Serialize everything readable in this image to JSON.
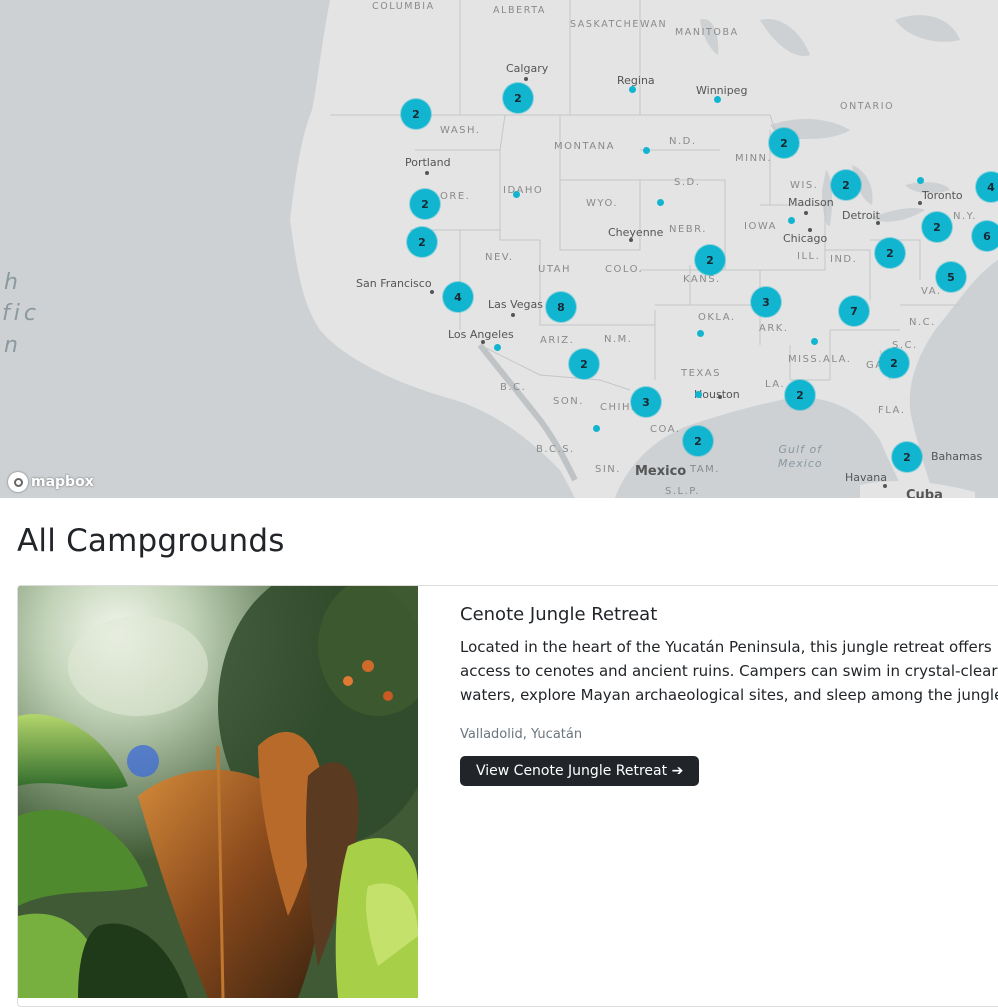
{
  "map": {
    "attribution": "mapbox",
    "pin_color": "#11b5d0",
    "clusters": [
      "2",
      "2",
      "2",
      "2",
      "2",
      "2",
      "4",
      "8",
      "2",
      "3",
      "2",
      "2",
      "3",
      "7",
      "2",
      "2",
      "2",
      "2",
      "5",
      "2",
      "4",
      "6"
    ],
    "labels": {
      "columbia": "COLUMBIA",
      "alberta": "ALBERTA",
      "saskatchewan": "SASKATCHEWAN",
      "manitoba": "MANITOBA",
      "ontario": "ONTARIO",
      "calgary": "Calgary",
      "regina": "Regina",
      "winnipeg": "Winnipeg",
      "wash": "WASH.",
      "montana": "MONTANA",
      "nd": "N.D.",
      "minn": "MINN.",
      "portland": "Portland",
      "ore": "ORE.",
      "idaho": "IDAHO",
      "wyo": "WYO.",
      "sd": "S.D.",
      "wis": "WIS.",
      "madison": "Madison",
      "toronto": "Toronto",
      "detroit": "Detroit",
      "ny": "N.Y.",
      "cheyenne": "Cheyenne",
      "nebr": "NEBR.",
      "iowa": "IOWA",
      "chicago": "Chicago",
      "nev": "NEV.",
      "utah": "UTAH",
      "colo": "COLO.",
      "ill": "ILL.",
      "ind": "IND.",
      "kans": "KANS.",
      "va": "VA.",
      "sanfrancisco": "San Francisco",
      "lasvegas": "Las Vegas",
      "okla": "OKLA.",
      "ark": "ARK.",
      "nc": "N.C.",
      "losangeles": "Los Angeles",
      "ariz": "ARIZ.",
      "nm": "N.M.",
      "sc": "S.C.",
      "miss": "MISS.",
      "ala": "ALA.",
      "ga": "GA.",
      "texas": "TEXAS",
      "bc": "B.C.",
      "la": "LA.",
      "houston": "Houston",
      "son": "SON.",
      "chih": "CHIH.",
      "fla": "FLA.",
      "coa": "COA.",
      "gulf1": "Gulf of",
      "gulf2": "Mexico",
      "bcs": "B.C.S.",
      "bahamas": "Bahamas",
      "sin": "SIN.",
      "mexico": "Mexico",
      "tam": "TAM.",
      "havana": "Havana",
      "slp": "S.L.P.",
      "cuba": "Cuba",
      "pac1": "h",
      "pac2": "fic",
      "pac3": "n"
    }
  },
  "page_title": "All Campgrounds",
  "campground": {
    "title": "Cenote Jungle Retreat",
    "description": "Located in the heart of the Yucatán Peninsula, this jungle retreat offers access to cenotes and ancient ruins. Campers can swim in crystal-clear waters, explore Mayan archaeological sites, and sleep among the jungle.",
    "location": "Valladolid, Yucatán",
    "button_label": "View Cenote Jungle Retreat"
  }
}
